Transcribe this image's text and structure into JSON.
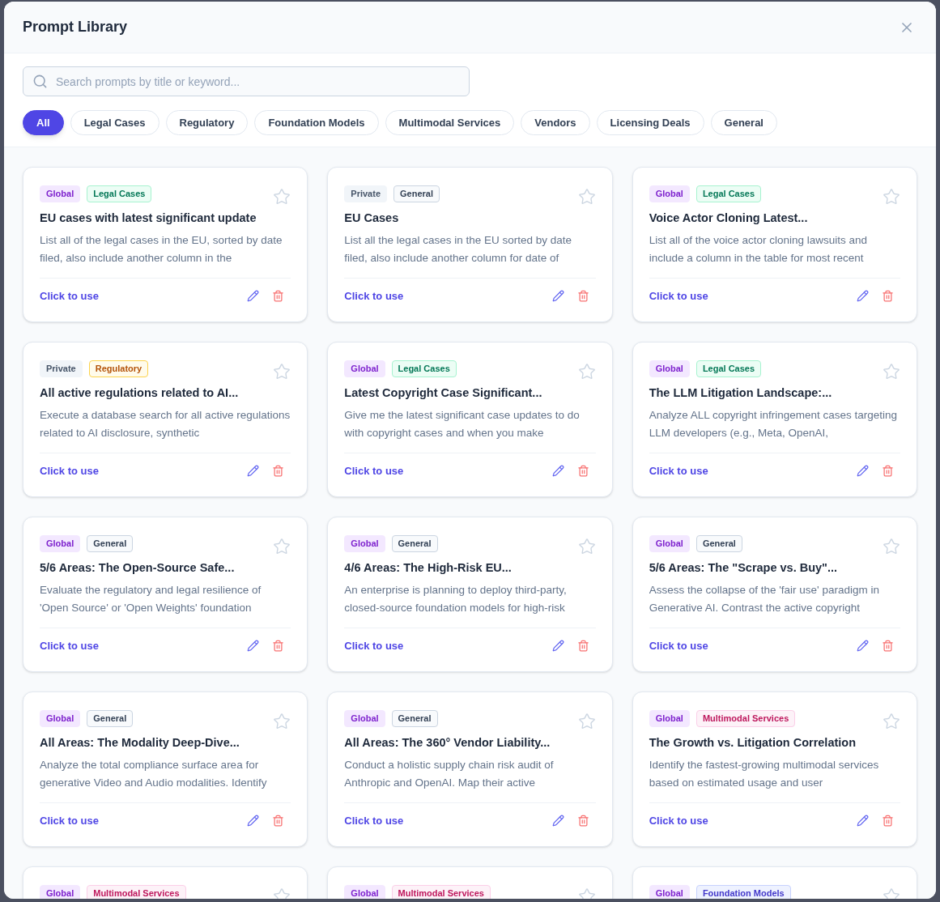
{
  "title": "Prompt Library",
  "search": {
    "placeholder": "Search prompts by title or keyword..."
  },
  "filters": [
    {
      "label": "All",
      "selected": true
    },
    {
      "label": "Legal Cases",
      "selected": false
    },
    {
      "label": "Regulatory",
      "selected": false
    },
    {
      "label": "Foundation Models",
      "selected": false
    },
    {
      "label": "Multimodal Services",
      "selected": false
    },
    {
      "label": "Vendors",
      "selected": false
    },
    {
      "label": "Licensing Deals",
      "selected": false
    },
    {
      "label": "General",
      "selected": false
    }
  ],
  "cards": [
    {
      "scope": {
        "label": "Global",
        "kind": "global"
      },
      "category": {
        "label": "Legal Cases",
        "kind": "legal"
      },
      "starred": false,
      "title": "EU cases with latest significant update",
      "description": "List all of the legal cases in the EU, sorted by date filed, also include another column in the",
      "action": "Click to use"
    },
    {
      "scope": {
        "label": "Private",
        "kind": "private"
      },
      "category": {
        "label": "General",
        "kind": "general"
      },
      "starred": false,
      "title": "EU Cases",
      "description": "List all the legal cases in the EU sorted by date filed, also include another column for date of",
      "action": "Click to use"
    },
    {
      "scope": {
        "label": "Global",
        "kind": "global"
      },
      "category": {
        "label": "Legal Cases",
        "kind": "legal"
      },
      "starred": false,
      "title": "Voice Actor Cloning Latest...",
      "description": "List all of the voice actor cloning lawsuits and include a column in the table for most recent",
      "action": "Click to use"
    },
    {
      "scope": {
        "label": "Private",
        "kind": "private"
      },
      "category": {
        "label": "Regulatory",
        "kind": "regulatory"
      },
      "starred": false,
      "title": "All active regulations related to AI...",
      "description": "Execute a database search for all active regulations related to AI disclosure, synthetic",
      "action": "Click to use"
    },
    {
      "scope": {
        "label": "Global",
        "kind": "global"
      },
      "category": {
        "label": "Legal Cases",
        "kind": "legal"
      },
      "starred": false,
      "title": "Latest Copyright Case Significant...",
      "description": "Give me the latest significant case updates to do with copyright cases and when you make",
      "action": "Click to use"
    },
    {
      "scope": {
        "label": "Global",
        "kind": "global"
      },
      "category": {
        "label": "Legal Cases",
        "kind": "legal"
      },
      "starred": false,
      "title": "The LLM Litigation Landscape:...",
      "description": "Analyze ALL copyright infringement cases targeting LLM developers (e.g., Meta, OpenAI,",
      "action": "Click to use"
    },
    {
      "scope": {
        "label": "Global",
        "kind": "global"
      },
      "category": {
        "label": "General",
        "kind": "general"
      },
      "starred": false,
      "title": "5/6 Areas: The Open-Source Safe...",
      "description": "Evaluate the regulatory and legal resilience of 'Open Source' or 'Open Weights' foundation",
      "action": "Click to use"
    },
    {
      "scope": {
        "label": "Global",
        "kind": "global"
      },
      "category": {
        "label": "General",
        "kind": "general"
      },
      "starred": false,
      "title": "4/6 Areas: The High-Risk EU...",
      "description": "An enterprise is planning to deploy third-party, closed-source foundation models for high-risk",
      "action": "Click to use"
    },
    {
      "scope": {
        "label": "Global",
        "kind": "global"
      },
      "category": {
        "label": "General",
        "kind": "general"
      },
      "starred": false,
      "title": "5/6 Areas: The \"Scrape vs. Buy\"...",
      "description": "Assess the collapse of the 'fair use' paradigm in Generative AI. Contrast the active copyright",
      "action": "Click to use"
    },
    {
      "scope": {
        "label": "Global",
        "kind": "global"
      },
      "category": {
        "label": "General",
        "kind": "general"
      },
      "starred": false,
      "title": "All Areas: The Modality Deep-Dive...",
      "description": "Analyze the total compliance surface area for generative Video and Audio modalities. Identify",
      "action": "Click to use"
    },
    {
      "scope": {
        "label": "Global",
        "kind": "global"
      },
      "category": {
        "label": "General",
        "kind": "general"
      },
      "starred": false,
      "title": "All Areas: The 360° Vendor Liability...",
      "description": "Conduct a holistic supply chain risk audit of Anthropic and OpenAI. Map their active",
      "action": "Click to use"
    },
    {
      "scope": {
        "label": "Global",
        "kind": "global"
      },
      "category": {
        "label": "Multimodal Services",
        "kind": "multimodal"
      },
      "starred": false,
      "title": "The Growth vs. Litigation Correlation",
      "description": "Identify the fastest-growing multimodal services based on estimated usage and user",
      "action": "Click to use"
    },
    {
      "scope": {
        "label": "Global",
        "kind": "global"
      },
      "category": {
        "label": "Multimodal Services",
        "kind": "multimodal"
      },
      "starred": false
    },
    {
      "scope": {
        "label": "Global",
        "kind": "global"
      },
      "category": {
        "label": "Multimodal Services",
        "kind": "multimodal"
      },
      "starred": false
    },
    {
      "scope": {
        "label": "Global",
        "kind": "global"
      },
      "category": {
        "label": "Foundation Models",
        "kind": "foundation"
      },
      "starred": false
    }
  ]
}
